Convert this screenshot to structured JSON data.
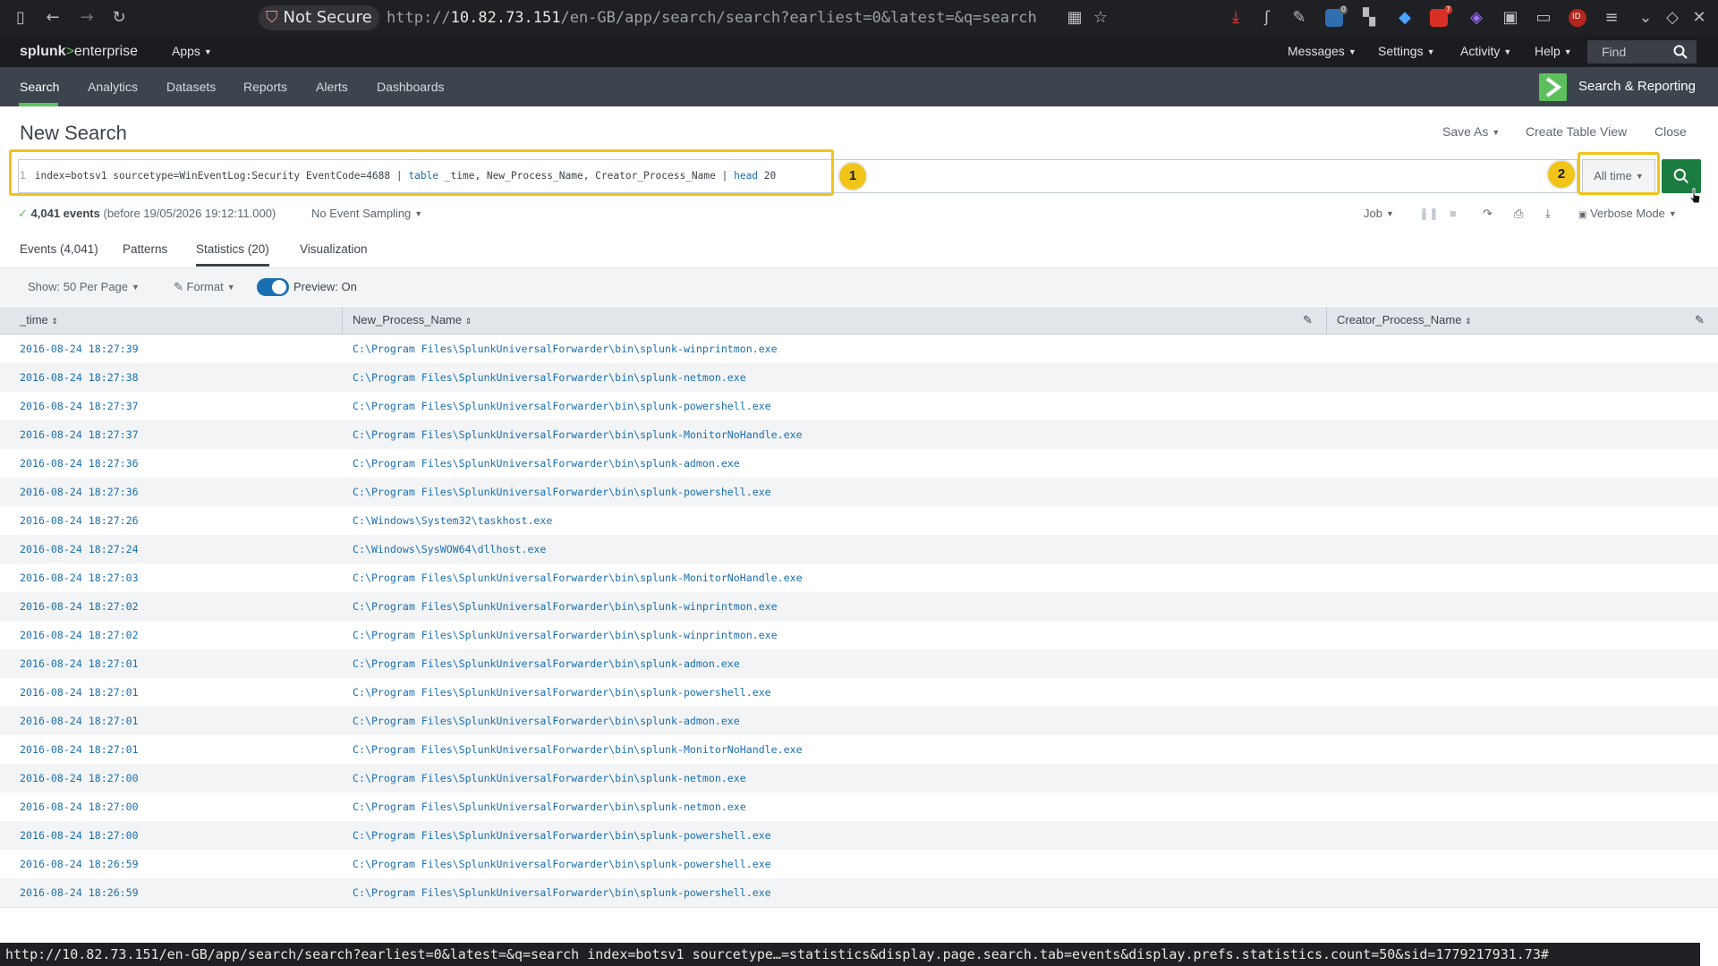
{
  "browser": {
    "security_label": "Not Secure",
    "url_scheme": "http://",
    "url_host": "10.82.73.151",
    "url_path": "/en-GB/app/search/search?earliest=0&latest=&q=search",
    "extension_badges": [
      "0",
      "7",
      "ID"
    ]
  },
  "header": {
    "brand_splunk": "splunk",
    "brand_gt": ">",
    "brand_product": "enterprise",
    "apps_label": "Apps",
    "messages_label": "Messages",
    "settings_label": "Settings",
    "activity_label": "Activity",
    "help_label": "Help",
    "find_placeholder": "Find"
  },
  "appbar": {
    "tabs": [
      "Search",
      "Analytics",
      "Datasets",
      "Reports",
      "Alerts",
      "Dashboards"
    ],
    "app_name": "Search & Reporting"
  },
  "page": {
    "title": "New Search",
    "save_as": "Save As",
    "create_table_view": "Create Table View",
    "close": "Close"
  },
  "search": {
    "line_number": "1",
    "query_part1": "index=botsv1 sourcetype=WinEventLog:Security EventCode=4688 | ",
    "kw_table": "table",
    "query_part2": " _time, New_Process_Name, Creator_Process_Name | ",
    "kw_head": "head",
    "query_part3": " 20",
    "step1": "1",
    "step2": "2",
    "time_range": "All time"
  },
  "status": {
    "events": "4,041 events",
    "before": "(before 19/05/2026 19:12:11.000)",
    "sampling": "No Event Sampling",
    "job": "Job",
    "mode": "Verbose Mode"
  },
  "result_tabs": [
    "Events (4,041)",
    "Patterns",
    "Statistics (20)",
    "Visualization"
  ],
  "controls": {
    "show": "Show: 50 Per Page",
    "format": "Format",
    "preview": "Preview: On"
  },
  "table": {
    "columns": [
      "_time",
      "New_Process_Name",
      "Creator_Process_Name"
    ],
    "rows": [
      [
        "2016-08-24 18:27:39",
        "C:\\Program Files\\SplunkUniversalForwarder\\bin\\splunk-winprintmon.exe",
        ""
      ],
      [
        "2016-08-24 18:27:38",
        "C:\\Program Files\\SplunkUniversalForwarder\\bin\\splunk-netmon.exe",
        ""
      ],
      [
        "2016-08-24 18:27:37",
        "C:\\Program Files\\SplunkUniversalForwarder\\bin\\splunk-powershell.exe",
        ""
      ],
      [
        "2016-08-24 18:27:37",
        "C:\\Program Files\\SplunkUniversalForwarder\\bin\\splunk-MonitorNoHandle.exe",
        ""
      ],
      [
        "2016-08-24 18:27:36",
        "C:\\Program Files\\SplunkUniversalForwarder\\bin\\splunk-admon.exe",
        ""
      ],
      [
        "2016-08-24 18:27:36",
        "C:\\Program Files\\SplunkUniversalForwarder\\bin\\splunk-powershell.exe",
        ""
      ],
      [
        "2016-08-24 18:27:26",
        "C:\\Windows\\System32\\taskhost.exe",
        ""
      ],
      [
        "2016-08-24 18:27:24",
        "C:\\Windows\\SysWOW64\\dllhost.exe",
        ""
      ],
      [
        "2016-08-24 18:27:03",
        "C:\\Program Files\\SplunkUniversalForwarder\\bin\\splunk-MonitorNoHandle.exe",
        ""
      ],
      [
        "2016-08-24 18:27:02",
        "C:\\Program Files\\SplunkUniversalForwarder\\bin\\splunk-winprintmon.exe",
        ""
      ],
      [
        "2016-08-24 18:27:02",
        "C:\\Program Files\\SplunkUniversalForwarder\\bin\\splunk-winprintmon.exe",
        ""
      ],
      [
        "2016-08-24 18:27:01",
        "C:\\Program Files\\SplunkUniversalForwarder\\bin\\splunk-admon.exe",
        ""
      ],
      [
        "2016-08-24 18:27:01",
        "C:\\Program Files\\SplunkUniversalForwarder\\bin\\splunk-powershell.exe",
        ""
      ],
      [
        "2016-08-24 18:27:01",
        "C:\\Program Files\\SplunkUniversalForwarder\\bin\\splunk-admon.exe",
        ""
      ],
      [
        "2016-08-24 18:27:01",
        "C:\\Program Files\\SplunkUniversalForwarder\\bin\\splunk-MonitorNoHandle.exe",
        ""
      ],
      [
        "2016-08-24 18:27:00",
        "C:\\Program Files\\SplunkUniversalForwarder\\bin\\splunk-netmon.exe",
        ""
      ],
      [
        "2016-08-24 18:27:00",
        "C:\\Program Files\\SplunkUniversalForwarder\\bin\\splunk-netmon.exe",
        ""
      ],
      [
        "2016-08-24 18:27:00",
        "C:\\Program Files\\SplunkUniversalForwarder\\bin\\splunk-powershell.exe",
        ""
      ],
      [
        "2016-08-24 18:26:59",
        "C:\\Program Files\\SplunkUniversalForwarder\\bin\\splunk-powershell.exe",
        ""
      ],
      [
        "2016-08-24 18:26:59",
        "C:\\Program Files\\SplunkUniversalForwarder\\bin\\splunk-powershell.exe",
        ""
      ]
    ]
  },
  "status_bar": {
    "url": "http://10.82.73.151/en-GB/app/search/search?earliest=0&latest=&q=search index=botsv1 sourcetype…=statistics&display.page.search.tab=events&display.prefs.statistics.count=50&sid=1779217931.73#"
  },
  "colors": {
    "accent_green": "#5cc05c",
    "search_button": "#1a7c3f",
    "highlight": "#f0c419",
    "link_blue": "#1a6fb3"
  }
}
